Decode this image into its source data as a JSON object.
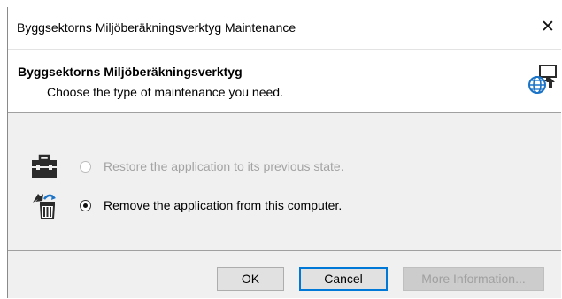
{
  "window": {
    "title": "Byggsektorns Miljöberäkningsverktyg Maintenance",
    "close_glyph": "✕"
  },
  "header": {
    "title": "Byggsektorns Miljöberäkningsverktyg",
    "subtitle": "Choose the type of maintenance you need.",
    "icon": "globe-computer-icon"
  },
  "options": [
    {
      "label": "Restore the application to its previous state.",
      "icon": "toolbox-icon",
      "selected": false,
      "enabled": false
    },
    {
      "label": "Remove the application from this computer.",
      "icon": "trash-remove-icon",
      "selected": true,
      "enabled": true
    }
  ],
  "buttons": {
    "ok": "OK",
    "cancel": "Cancel",
    "more_info": "More Information..."
  },
  "colors": {
    "dialog_bg": "#f0f0f0",
    "focus_border": "#0078d7",
    "disabled_text": "#a3a3a3"
  }
}
